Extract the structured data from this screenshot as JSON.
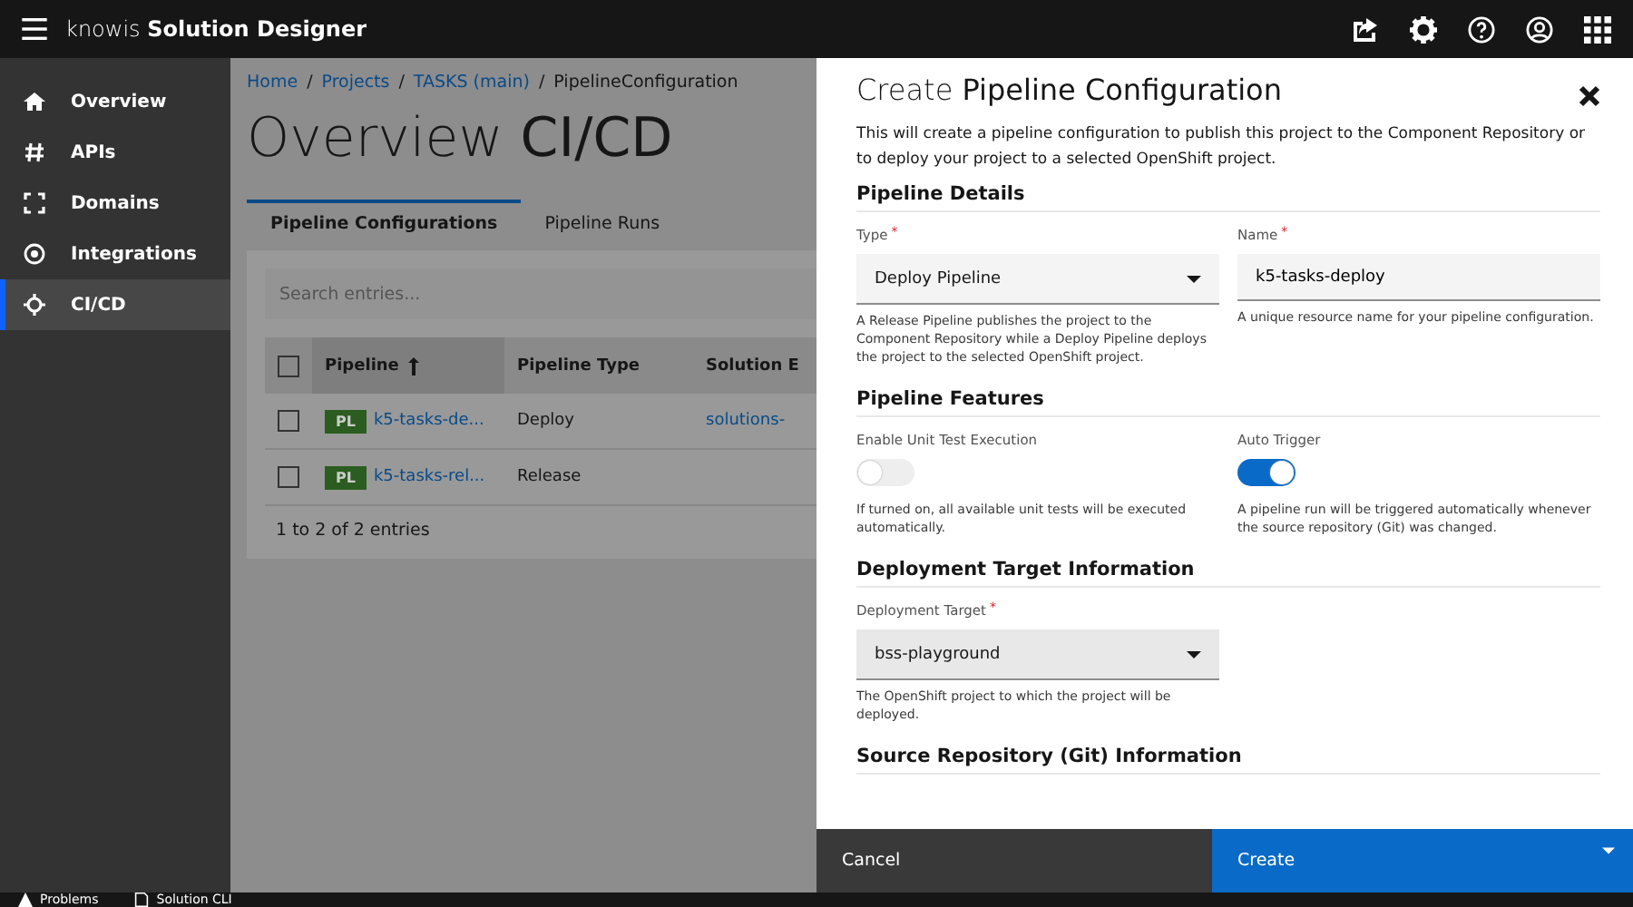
{
  "app_bar": {
    "brand_light": "knowis",
    "brand_bold": "Solution Designer"
  },
  "sidebar": {
    "items": [
      {
        "label": "Overview",
        "selected": false
      },
      {
        "label": "APIs",
        "selected": false
      },
      {
        "label": "Domains",
        "selected": false
      },
      {
        "label": "Integrations",
        "selected": false
      },
      {
        "label": "CI/CD",
        "selected": true
      }
    ]
  },
  "breadcrumb_separator": "/",
  "breadcrumb": [
    {
      "label": "Home",
      "link": true
    },
    {
      "label": "Projects",
      "link": true
    },
    {
      "label": "TASKS (main)",
      "link": true
    },
    {
      "label": "PipelineConfiguration",
      "link": false
    }
  ],
  "page_title": {
    "light": "Overview",
    "bold": "CI/CD"
  },
  "tabs": [
    {
      "label": "Pipeline Configurations",
      "selected": true
    },
    {
      "label": "Pipeline Runs",
      "selected": false
    }
  ],
  "table": {
    "header_checked": false,
    "search": {
      "placeholder": "Search entries..."
    },
    "columns": [
      {
        "label": "Pipeline",
        "sorted": true
      },
      {
        "label": "Pipeline Type",
        "sorted": false
      },
      {
        "label": "Solution E",
        "sorted": false
      }
    ],
    "rows": [
      {
        "checked": false,
        "tag": "PL",
        "name": "k5-tasks-de...",
        "type": "Deploy",
        "column_3": "solutions-"
      },
      {
        "checked": false,
        "tag": "PL",
        "name": "k5-tasks-rel...",
        "type": "Release",
        "column_3": ""
      }
    ],
    "footer": "1 to 2 of 2 entries"
  },
  "status_bar": [
    {
      "label": "Problems"
    },
    {
      "label": "Solution CLI"
    }
  ],
  "panel": {
    "required_mark": "*",
    "title_light": "Create",
    "title_bold": "Pipeline Configuration",
    "description": "This will create a pipeline configuration to publish this project to the Component Repository or to deploy your project to a selected OpenShift project.",
    "sections": [
      {
        "heading": "Pipeline Details",
        "fields": [
          {
            "kind": "select",
            "label": "Type",
            "required": true,
            "value": "Deploy Pipeline",
            "help": "A Release Pipeline publishes the project to the Component Repository while a Deploy Pipeline deploys the project to the selected OpenShift project."
          },
          {
            "kind": "text",
            "label": "Name",
            "required": true,
            "value": "k5-tasks-deploy",
            "help": "A unique resource name for your pipeline configuration."
          }
        ]
      },
      {
        "heading": "Pipeline Features",
        "fields": [
          {
            "kind": "toggle",
            "label": "Enable Unit Test Execution",
            "required": false,
            "on": false,
            "help": "If turned on, all available unit tests will be executed automatically."
          },
          {
            "kind": "toggle",
            "label": "Auto Trigger",
            "required": false,
            "on": true,
            "help": "A pipeline run will be triggered automatically whenever the source repository (Git) was changed."
          }
        ]
      },
      {
        "heading": "Deployment Target Information",
        "fields": [
          {
            "kind": "select",
            "label": "Deployment Target",
            "required": true,
            "value": "bss-playground",
            "help": "The OpenShift project to which the project will be deployed."
          }
        ]
      },
      {
        "heading": "Source Repository (Git) Information"
      }
    ],
    "cancel": "Cancel",
    "create": "Create"
  }
}
